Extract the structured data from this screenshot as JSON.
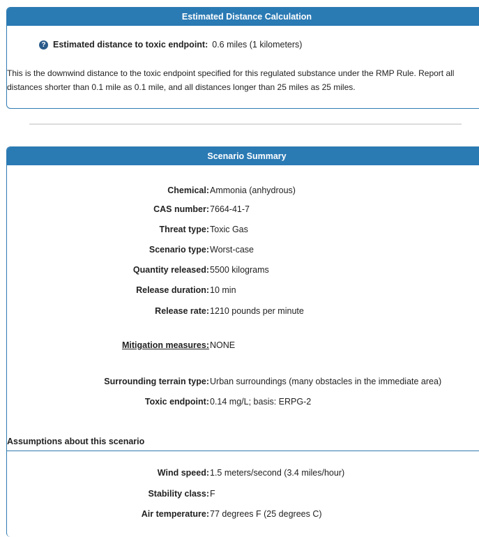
{
  "panel1": {
    "title": "Estimated Distance Calculation",
    "result_label": "Estimated distance to toxic endpoint:",
    "result_value": "0.6 miles (1 kilometers)",
    "description": "This is the downwind distance to the toxic endpoint specified for this regulated substance under the RMP Rule. Report all distances shorter than 0.1 mile as 0.1 mile, and all distances longer than 25 miles as 25 miles."
  },
  "panel2": {
    "title": "Scenario Summary",
    "rows": [
      {
        "label": "Chemical:",
        "value": "Ammonia (anhydrous)"
      },
      {
        "label": "CAS number:",
        "value": "7664-41-7"
      },
      {
        "label": "Threat type:",
        "value": "Toxic Gas"
      },
      {
        "label": "Scenario type:",
        "value": "Worst-case"
      },
      {
        "label": "Quantity released:",
        "value": "5500 kilograms"
      },
      {
        "label": "Release duration:",
        "value": "10 min"
      },
      {
        "label": "Release rate:",
        "value": "1210 pounds per minute"
      },
      {
        "label": "Mitigation measures:",
        "value": "NONE"
      },
      {
        "label": "Surrounding terrain type:",
        "value": "Urban surroundings (many obstacles in the immediate area)"
      },
      {
        "label": "Toxic endpoint:",
        "value": "0.14 mg/L; basis: ERPG-2"
      }
    ],
    "assumptions_title": "Assumptions about this scenario",
    "assumptions": [
      {
        "label": "Wind speed:",
        "value": "1.5 meters/second (3.4 miles/hour)"
      },
      {
        "label": "Stability class:",
        "value": "F"
      },
      {
        "label": "Air temperature:",
        "value": "77 degrees F (25 degrees C)"
      }
    ]
  },
  "icons": {
    "help": "help-icon"
  },
  "colors": {
    "header": "#2a7ab4",
    "border": "#2f7bb0"
  }
}
